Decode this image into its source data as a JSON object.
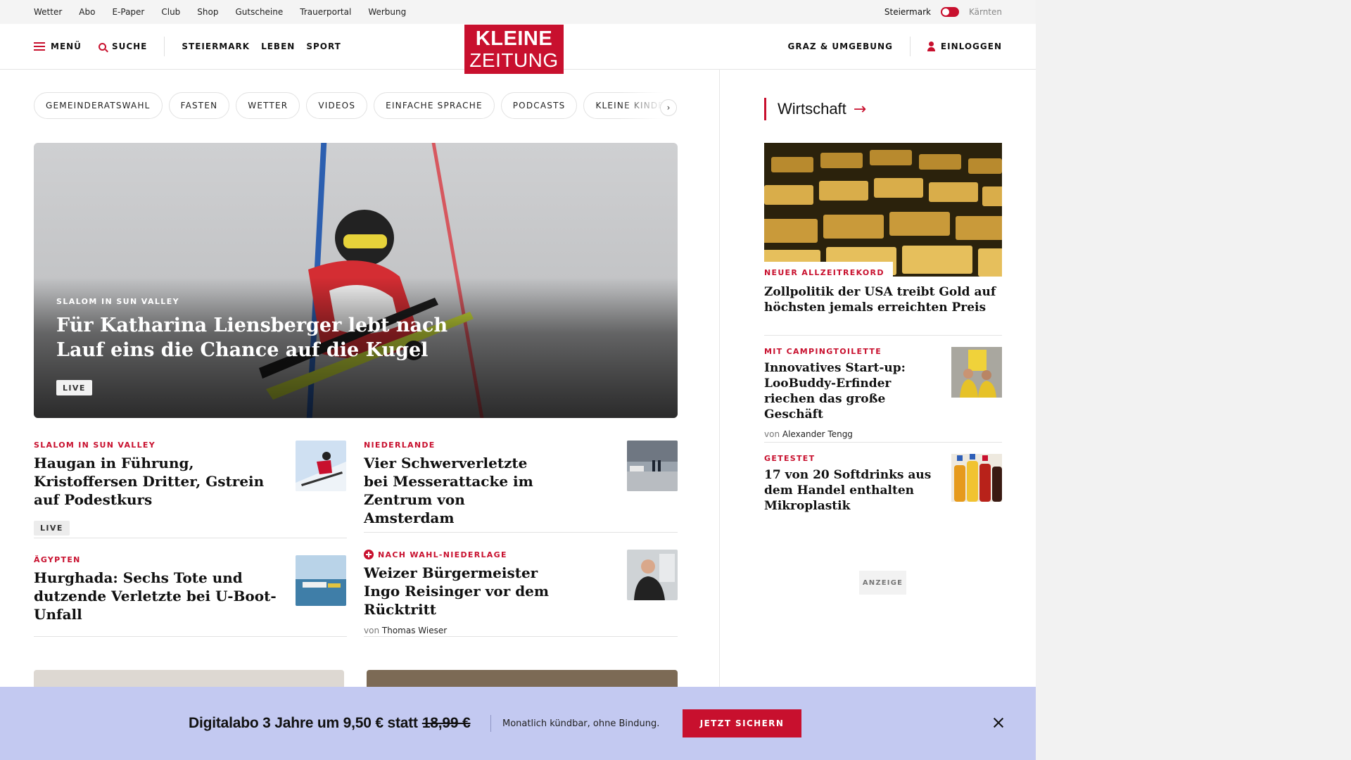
{
  "utility": {
    "links": [
      "Wetter",
      "Abo",
      "E-Paper",
      "Club",
      "Shop",
      "Gutscheine",
      "Trauerportal",
      "Werbung"
    ],
    "region_active": "Steiermark",
    "region_inactive": "Kärnten"
  },
  "header": {
    "menu": "MENÜ",
    "search": "SUCHE",
    "nav": [
      "STEIERMARK",
      "LEBEN",
      "SPORT"
    ],
    "logo_line1": "KLEINE",
    "logo_line2": "ZEITUNG",
    "region_link": "GRAZ & UMGEBUNG",
    "login": "EINLOGGEN"
  },
  "tags": [
    "GEMEINDERATSWAHL",
    "FASTEN",
    "WETTER",
    "VIDEOS",
    "EINFACHE SPRACHE",
    "PODCASTS",
    "KLEINE KINDER"
  ],
  "hero": {
    "kicker": "SLALOM IN SUN VALLEY",
    "title": "Für Katharina Liensberger lebt nach Lauf eins die Chance auf die Kugel",
    "badge": "LIVE"
  },
  "articles": [
    {
      "kicker": "SLALOM IN SUN VALLEY",
      "title": "Haugan in Führung, Kristoffersen Dritter, Gstrein auf Podestkurs",
      "badge": "LIVE",
      "thumb": "skier-thumbnail"
    },
    {
      "kicker": "NIEDERLANDE",
      "title": "Vier Schwerverletzte bei Messerattacke im Zentrum von Amsterdam",
      "thumb": "police-street-thumbnail"
    },
    {
      "kicker": "ÄGYPTEN",
      "title": "Hurghada: Sechs Tote und dutzende Verletzte bei U-Boot-Unfall",
      "thumb": "sea-boat-thumbnail"
    },
    {
      "kicker": "NACH WAHL-NIEDERLAGE",
      "title": "Weizer Bürgermeister Ingo Reisinger vor dem Rücktritt",
      "byline_prefix": "von",
      "byline_author": "Thomas Wieser",
      "thumb": "mayor-portrait-thumbnail",
      "premium": true
    }
  ],
  "sidebar": {
    "section": "Wirtschaft",
    "arrow": "→",
    "lead": {
      "kicker": "NEUER ALLZEITREKORD",
      "title": "Zollpolitik der USA treibt Gold auf höchsten jemals erreichten Preis"
    },
    "items": [
      {
        "kicker": "MIT CAMPINGTOILETTE",
        "title": "Innovatives Start-up: LooBuddy-Erfinder riechen das große Geschäft",
        "byline_prefix": "von",
        "byline_author": "Alexander Tengg"
      },
      {
        "kicker": "GETESTET",
        "title": "17 von 20 Softdrinks aus dem Handel enthalten Mikroplastik"
      }
    ],
    "ad_label": "ANZEIGE"
  },
  "promo": {
    "headline": "Digitalabo 3 Jahre um 9,50 € statt",
    "old_price": "18,99 €",
    "sub": "Monatlich kündbar, ohne Bindung.",
    "cta": "JETZT SICHERN"
  },
  "colors": {
    "brand_red": "#c8102e",
    "promo_bg": "#c3c9f1"
  }
}
